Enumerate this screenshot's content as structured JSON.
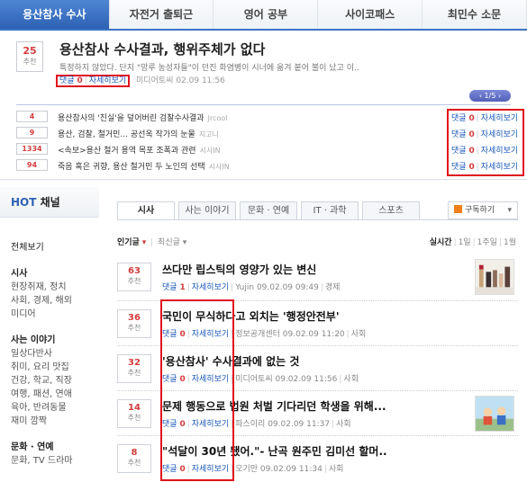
{
  "top": {
    "tabs": [
      "용산참사 수사",
      "자전거 출퇴근",
      "영어 공부",
      "사이코패스",
      "최민수 소문"
    ],
    "hero": {
      "rec_count": "25",
      "rec_label": "추천",
      "title": "용산참사 수사결과, 행위주체가 없다",
      "summary": "특정하지 않았다. 단지 \"망루 농성자들\"이 던진 화염병이 시너에 옮겨 붙어 불이 났고 이..",
      "comment_label": "댓글",
      "comment_count": "0",
      "detail_label": "자세히보기",
      "source": "미디어토씨",
      "date": "02.09 11:56"
    },
    "pager": "‹ 1/5 ›",
    "rows": [
      {
        "count": "4",
        "title": "용산참사의 '진실'을 덮어버린 검찰수사결과",
        "source": "Jrcool"
      },
      {
        "count": "9",
        "title": "용산, 검찰, 철거민... 공선옥 작가의 눈물",
        "source": "지고니"
      },
      {
        "count": "1334",
        "title": "<속보>용산 철거 용역 목포 조폭과 관련",
        "source": "시사IN"
      },
      {
        "count": "94",
        "title": "죽음 혹은 귀향, 용산 철거민 두 노인의 선택",
        "source": "시사IN"
      }
    ],
    "row_comment_label": "댓글",
    "row_comment_count": "0",
    "row_detail_label": "자세히보기"
  },
  "side": {
    "title_hot": "HOT",
    "title_rest": "채널",
    "items": [
      {
        "label": "전체보기",
        "type": "first"
      },
      {
        "label": "시사",
        "type": "h"
      },
      {
        "label": "현장취재, 정치",
        "type": "i"
      },
      {
        "label": "사회, 경제, 해외",
        "type": "i"
      },
      {
        "label": "미디어",
        "type": "i"
      },
      {
        "label": "사는 이야기",
        "type": "h"
      },
      {
        "label": "일상다반사",
        "type": "i"
      },
      {
        "label": "취미, 요리 맛집",
        "type": "i"
      },
      {
        "label": "건강, 학교, 직장",
        "type": "i"
      },
      {
        "label": "여행, 패션, 연애",
        "type": "i"
      },
      {
        "label": "육아, 반려동물",
        "type": "i"
      },
      {
        "label": "재미 깜짝",
        "type": "i"
      },
      {
        "label": "문화 · 연예",
        "type": "h"
      },
      {
        "label": "문화, TV 드라마",
        "type": "i"
      }
    ]
  },
  "main": {
    "tabs": [
      "시사",
      "사는 이야기",
      "문화 · 연예",
      "IT · 과학",
      "스포츠"
    ],
    "subscribe": "구독하기",
    "sort_popular": "인기글",
    "sort_new": "최신글",
    "period_label": "실시간",
    "period_1d": "1일",
    "period_1w": "1주일",
    "period_1m": "1월",
    "rec_label": "추천",
    "comment_label": "댓글",
    "detail_label": "자세히보기",
    "articles": [
      {
        "count": "63",
        "title": "쓰다만 립스틱의 영양가 있는 변신",
        "comments": "1",
        "author": "Yujin",
        "date": "09.02.09 09:49",
        "category": "경제"
      },
      {
        "count": "36",
        "title": "국민이 무식하다고 외치는 '행정안전부'",
        "comments": "0",
        "author": "정보공개센터",
        "date": "09.02.09 11:20",
        "category": "사회"
      },
      {
        "count": "32",
        "title": "'용산참사' 수사결과에 없는 것",
        "comments": "0",
        "author": "미디어토씨",
        "date": "09.02.09 11:56",
        "category": "사회"
      },
      {
        "count": "14",
        "title": "문제 행동으로 법원 처벌 기다리던 학생을 위해...",
        "comments": "0",
        "author": "파스이리",
        "date": "09.02.09 11:37",
        "category": "사회"
      },
      {
        "count": "8",
        "title": "\"석달이 30년 됐어.\"- 난곡 원주민 김미선 할머..",
        "comments": "0",
        "author": "오기만",
        "date": "09.02.09 11:34",
        "category": "사회"
      }
    ]
  }
}
